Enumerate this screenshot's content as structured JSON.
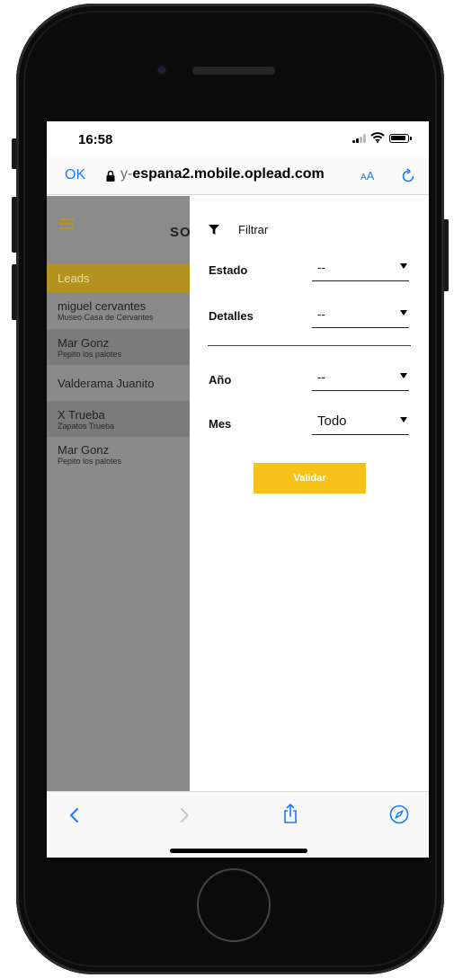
{
  "status_bar": {
    "time": "16:58"
  },
  "browser": {
    "ok_label": "OK",
    "url_faded": "y-",
    "url_main": "espana2.mobile.oplead.com",
    "text_size_label_small": "A",
    "text_size_label_big": "A"
  },
  "app": {
    "title": "SO",
    "leads_label": "Leads",
    "leads": [
      {
        "name": "miguel cervantes",
        "subtitle": "Museo Casa de Cervantes"
      },
      {
        "name": "Mar Gonz",
        "subtitle": "Pepito los palotes"
      },
      {
        "name": "Valderama Juanito",
        "subtitle": ""
      },
      {
        "name": "X Trueba",
        "subtitle": "Zapatos Trueba"
      },
      {
        "name": "Mar Gonz",
        "subtitle": "Pepito los palotes"
      }
    ]
  },
  "filter": {
    "title": "Filtrar",
    "fields": [
      {
        "label": "Estado",
        "value": "--"
      },
      {
        "label": "Detalles",
        "value": "--"
      },
      {
        "label": "Año",
        "value": "--"
      },
      {
        "label": "Mes",
        "value": "Todo"
      }
    ],
    "validate_label": "Validar"
  },
  "colors": {
    "accent": "#f6c21a",
    "link_blue": "#1a7cf5",
    "leads_bar": "#b3921f",
    "overlay_gray": "#8a8a8a"
  },
  "icons": [
    "signal-icon",
    "wifi-icon",
    "battery-icon",
    "lock-icon",
    "reload-icon",
    "menu-icon",
    "filter-icon",
    "caret-down-icon",
    "back-icon",
    "forward-icon",
    "share-icon",
    "compass-icon"
  ]
}
